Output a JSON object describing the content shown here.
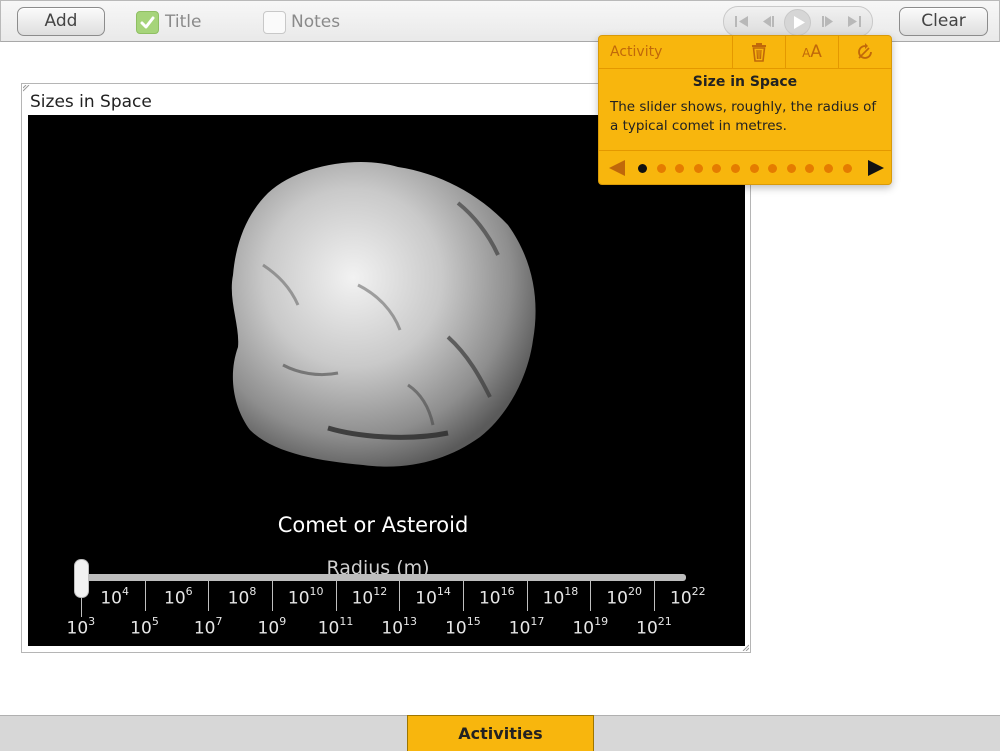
{
  "toolbar": {
    "add_label": "Add",
    "title_label": "Title",
    "title_checked": true,
    "notes_label": "Notes",
    "notes_checked": false,
    "clear_label": "Clear",
    "transport": [
      "skip-to-start-icon",
      "step-back-icon",
      "play-icon",
      "step-forward-icon",
      "skip-to-end-icon"
    ]
  },
  "widget": {
    "title": "Sizes in Space",
    "object_name": "Comet or Asteroid",
    "slider_title": "Radius (m)",
    "slider_value_exponent": 3,
    "scale_upper": [
      {
        "base": "10",
        "exp": "4"
      },
      {
        "base": "10",
        "exp": "6"
      },
      {
        "base": "10",
        "exp": "8"
      },
      {
        "base": "10",
        "exp": "10"
      },
      {
        "base": "10",
        "exp": "12"
      },
      {
        "base": "10",
        "exp": "14"
      },
      {
        "base": "10",
        "exp": "16"
      },
      {
        "base": "10",
        "exp": "18"
      },
      {
        "base": "10",
        "exp": "20"
      },
      {
        "base": "10",
        "exp": "22"
      }
    ],
    "scale_lower": [
      {
        "base": "10",
        "exp": "3"
      },
      {
        "base": "10",
        "exp": "5"
      },
      {
        "base": "10",
        "exp": "7"
      },
      {
        "base": "10",
        "exp": "9"
      },
      {
        "base": "10",
        "exp": "11"
      },
      {
        "base": "10",
        "exp": "13"
      },
      {
        "base": "10",
        "exp": "15"
      },
      {
        "base": "10",
        "exp": "17"
      },
      {
        "base": "10",
        "exp": "19"
      },
      {
        "base": "10",
        "exp": "21"
      }
    ]
  },
  "popup": {
    "header_label": "Activity",
    "icons": [
      "trash-icon",
      "text-size-icon",
      "rotate-icon"
    ],
    "text_size_small": "A",
    "text_size_big": "A",
    "title": "Size in Space",
    "body": "The slider shows, roughly, the radius of a typical comet in metres.",
    "page_count": 12,
    "current_page": 1
  },
  "bottom": {
    "activities_label": "Activities"
  },
  "colors": {
    "accent": "#f8b60d",
    "accent_text": "#c0680a",
    "checkbox_on": "#a6d47a"
  }
}
